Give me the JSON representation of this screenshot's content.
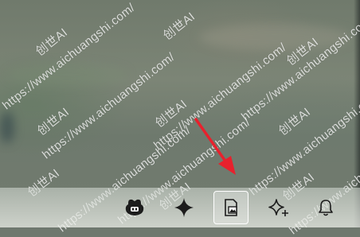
{
  "watermark": {
    "brand": "创世AI",
    "url": "https://www.aichuangshi.com/"
  },
  "taskbar": {
    "items": [
      {
        "icon": "copilot-bot-icon"
      },
      {
        "icon": "sparkle-icon"
      },
      {
        "icon": "image-document-icon",
        "active": true
      },
      {
        "icon": "sparkles-plus-icon"
      },
      {
        "icon": "bell-icon"
      }
    ]
  },
  "annotation": {
    "color": "#e8212d"
  }
}
